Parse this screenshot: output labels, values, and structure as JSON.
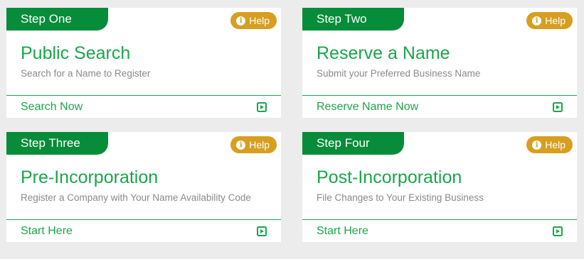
{
  "cards": [
    {
      "step": "Step One",
      "help": "Help",
      "title": "Public Search",
      "description": "Search for a Name to Register",
      "action": "Search Now"
    },
    {
      "step": "Step Two",
      "help": "Help",
      "title": "Reserve a Name",
      "description": "Submit your Preferred Business Name",
      "action": "Reserve Name Now"
    },
    {
      "step": "Step Three",
      "help": "Help",
      "title": "Pre-Incorporation",
      "description": "Register a Company with Your Name Availability Code",
      "action": "Start Here"
    },
    {
      "step": "Step Four",
      "help": "Help",
      "title": "Post-Incorporation",
      "description": "File Changes to Your Existing Business",
      "action": "Start Here"
    }
  ],
  "icons": {
    "help": "info-icon",
    "action": "play-icon"
  },
  "colors": {
    "brand_green": "#078c3a",
    "text_green": "#1aa64a",
    "help_gold": "#d79e1f",
    "description_gray": "#8a8a8a",
    "background": "#ececec"
  }
}
